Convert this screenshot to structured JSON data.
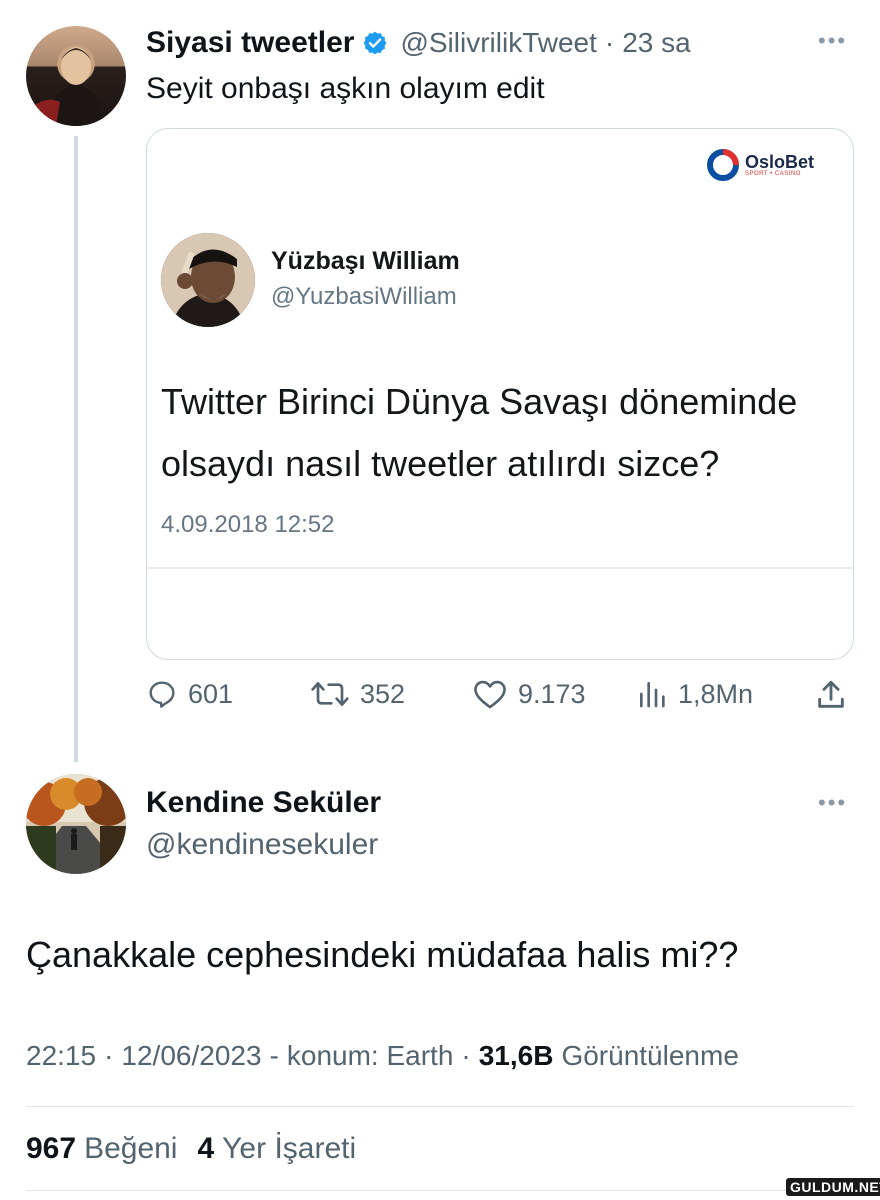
{
  "tweet": {
    "author_name": "Siyasi tweetler",
    "author_handle": "@SilivrilikTweet",
    "separator": "·",
    "time_ago": "23 sa",
    "text": "Seyit onbaşı aşkın olayım edit",
    "embed": {
      "brand_name": "OsloBet",
      "brand_sub": "SPORT • CASINO",
      "quoted_name": "Yüzbaşı William",
      "quoted_handle": "@YuzbasiWilliam",
      "quoted_text_line1": "Twitter Birinci Dünya Savaşı döneminde",
      "quoted_text_line2": "olsaydı nasıl tweetler atılırdı sizce?",
      "quoted_date": "4.09.2018 12:52"
    },
    "actions": {
      "replies": "601",
      "retweets": "352",
      "likes": "9.173",
      "views": "1,8Mn"
    }
  },
  "reply": {
    "author_name": "Kendine Seküler",
    "author_handle": "@kendinesekuler",
    "text": "Çanakkale cephesindeki müdafaa halis mi??",
    "meta": {
      "time": "22:15",
      "dot1": "·",
      "date": "12/06/2023",
      "dash": "-",
      "location": "konum: Earth",
      "dot2": "·",
      "views_count": "31,6B",
      "views_label": "Görüntülenme"
    },
    "stats": {
      "likes_count": "967",
      "likes_label": "Beğeni",
      "bookmarks_count": "4",
      "bookmarks_label": "Yer İşareti"
    }
  },
  "watermark": "GULDUM.NET",
  "colors": {
    "verified": "#1d9bf0",
    "muted": "#536471",
    "oslobet_blue": "#0b4fa3",
    "oslobet_red": "#e0312f"
  },
  "icons": [
    "verified-badge-icon",
    "more-icon",
    "reply-icon",
    "retweet-icon",
    "like-icon",
    "views-icon",
    "share-icon"
  ]
}
